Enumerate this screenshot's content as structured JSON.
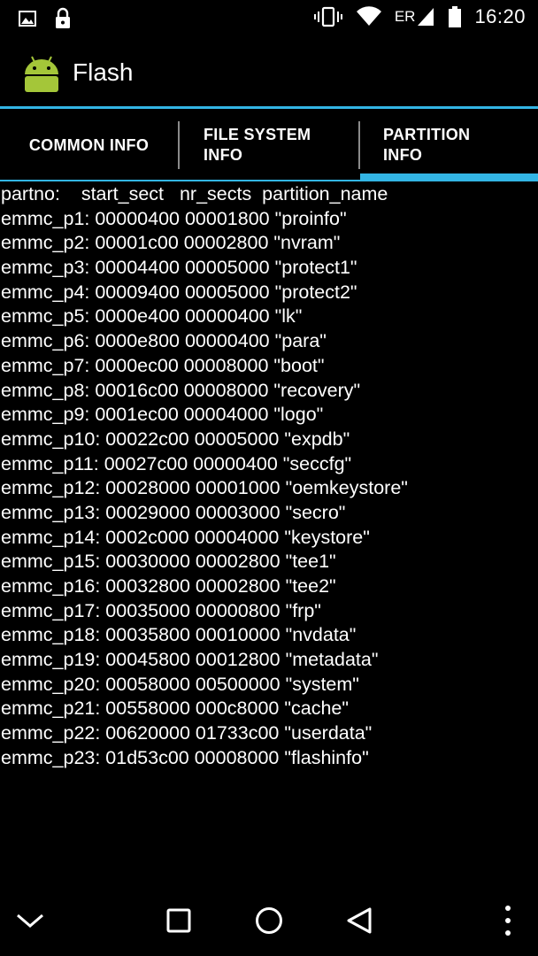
{
  "status_bar": {
    "time": "16:20",
    "carrier_indicator": "ER",
    "icons": [
      "image-icon",
      "lock-icon",
      "vibrate-icon",
      "wifi-icon",
      "signal-icon",
      "battery-icon"
    ]
  },
  "app": {
    "title": "Flash",
    "accent_color": "#33b5e5"
  },
  "tabs": [
    {
      "label": "COMMON INFO",
      "selected": false
    },
    {
      "label": "FILE SYSTEM\nINFO",
      "selected": false
    },
    {
      "label": "PARTITION\nINFO",
      "selected": true
    }
  ],
  "partition_table": {
    "header": "partno:    start_sect   nr_sects  partition_name",
    "rows": [
      "emmc_p1: 00000400 00001800 \"proinfo\"",
      "emmc_p2: 00001c00 00002800 \"nvram\"",
      "emmc_p3: 00004400 00005000 \"protect1\"",
      "emmc_p4: 00009400 00005000 \"protect2\"",
      "emmc_p5: 0000e400 00000400 \"lk\"",
      "emmc_p6: 0000e800 00000400 \"para\"",
      "emmc_p7: 0000ec00 00008000 \"boot\"",
      "emmc_p8: 00016c00 00008000 \"recovery\"",
      "emmc_p9: 0001ec00 00004000 \"logo\"",
      "emmc_p10: 00022c00 00005000 \"expdb\"",
      "emmc_p11: 00027c00 00000400 \"seccfg\"",
      "emmc_p12: 00028000 00001000 \"oemkeystore\"",
      "emmc_p13: 00029000 00003000 \"secro\"",
      "emmc_p14: 0002c000 00004000 \"keystore\"",
      "emmc_p15: 00030000 00002800 \"tee1\"",
      "emmc_p16: 00032800 00002800 \"tee2\"",
      "emmc_p17: 00035000 00000800 \"frp\"",
      "emmc_p18: 00035800 00010000 \"nvdata\"",
      "emmc_p19: 00045800 00012800 \"metadata\"",
      "emmc_p20: 00058000 00500000 \"system\"",
      "emmc_p21: 00558000 000c8000 \"cache\"",
      "emmc_p22: 00620000 01733c00 \"userdata\"",
      "emmc_p23: 01d53c00 00008000 \"flashinfo\""
    ]
  },
  "nav_bar": {
    "buttons": [
      "chevron-down-icon",
      "recents-icon",
      "home-icon",
      "back-icon",
      "more-vert-icon"
    ]
  }
}
